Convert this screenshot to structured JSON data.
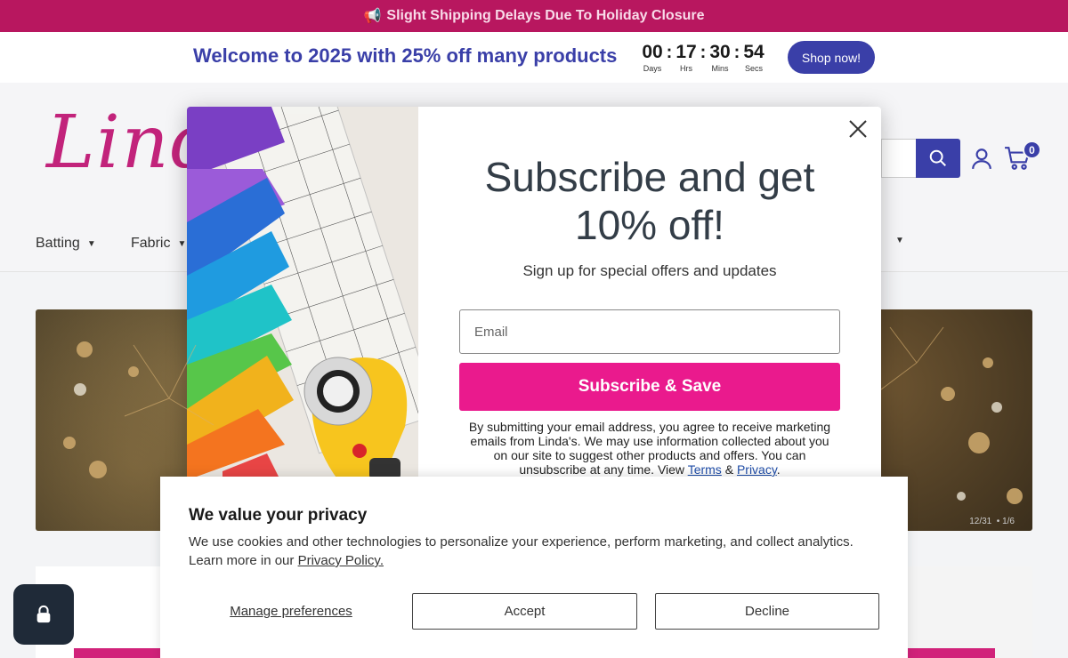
{
  "announcement": {
    "text": "Slight Shipping Delays Due To Holiday Closure",
    "icon": "megaphone-icon"
  },
  "promo": {
    "text": "Welcome to 2025 with 25% off many products",
    "countdown": [
      {
        "value": "00",
        "label": "Days"
      },
      {
        "value": "17",
        "label": "Hrs"
      },
      {
        "value": "30",
        "label": "Mins"
      },
      {
        "value": "54",
        "label": "Secs"
      }
    ],
    "button_label": "Shop now!"
  },
  "header": {
    "logo_text": "Lind",
    "cart_count": "0",
    "nav": [
      {
        "label": "Batting"
      },
      {
        "label": "Fabric"
      }
    ]
  },
  "hero": {
    "counter_date": "12/31",
    "counter_pages": "1/6"
  },
  "popup": {
    "title": "Subscribe and get 10% off!",
    "subtitle": "Sign up for special offers and updates",
    "email_placeholder": "Email",
    "submit_label": "Subscribe & Save",
    "legal_text": "By submitting your email address, you agree to receive marketing emails from Linda's. We may use information collected about you on our site to suggest other products and offers. You can unsubscribe at any time. View",
    "terms_label": "Terms",
    "and_label": "&",
    "privacy_label": "Privacy",
    "period": "."
  },
  "cookie": {
    "title": "We value your privacy",
    "text": "We use cookies and other technologies to personalize your experience, perform marketing, and collect analytics. Learn more in our",
    "policy_link": "Privacy Policy.",
    "manage_label": "Manage preferences",
    "accept_label": "Accept",
    "decline_label": "Decline"
  },
  "colors": {
    "brand_pink": "#ea1a8d",
    "brand_blue": "#3a3fa8",
    "announcement_bg": "#b8175f"
  }
}
